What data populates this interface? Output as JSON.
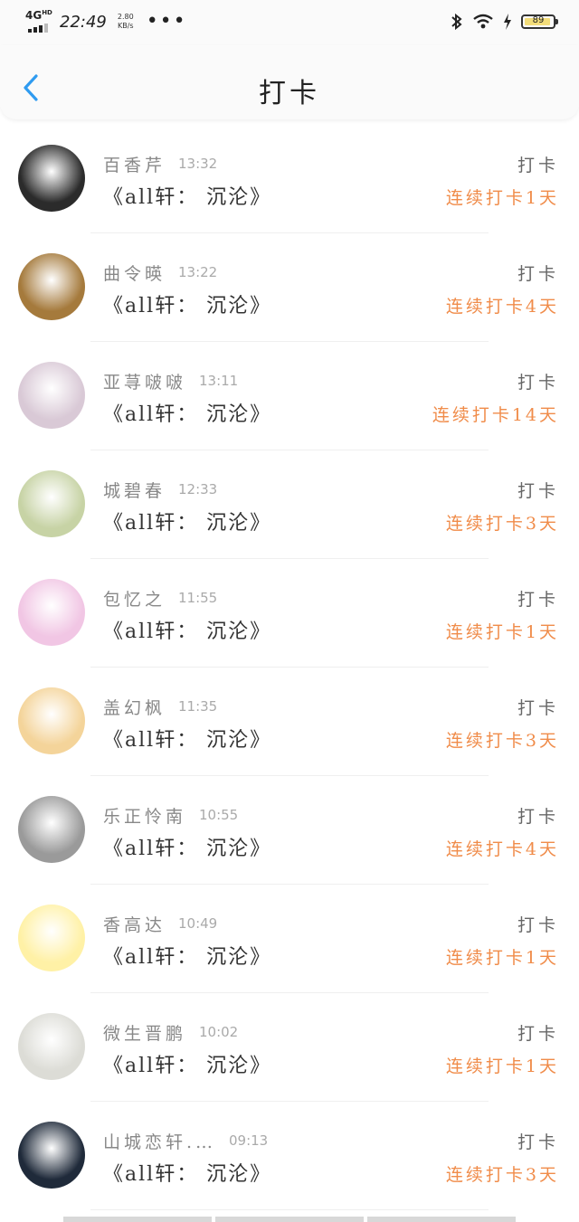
{
  "status": {
    "network": "4G",
    "network_sup": "HD",
    "time": "22:49",
    "speed_value": "2.80",
    "speed_unit": "KB/s",
    "more": "•••",
    "battery": "89"
  },
  "header": {
    "title": "打卡"
  },
  "rows": [
    {
      "name": "百香芹",
      "time": "13:32",
      "book": "《all轩： 沉沦》",
      "action": "打卡",
      "streak": "连续打卡1天",
      "avatar_color": "#2b2b2b"
    },
    {
      "name": "曲令暎",
      "time": "13:22",
      "book": "《all轩： 沉沦》",
      "action": "打卡",
      "streak": "连续打卡4天",
      "avatar_color": "#a57a3c"
    },
    {
      "name": "亚荨啵啵",
      "time": "13:11",
      "book": "《all轩： 沉沦》",
      "action": "打卡",
      "streak": "连续打卡14天",
      "avatar_color": "#d9c9d6"
    },
    {
      "name": "城碧春",
      "time": "12:33",
      "book": "《all轩： 沉沦》",
      "action": "打卡",
      "streak": "连续打卡3天",
      "avatar_color": "#c7d3a5"
    },
    {
      "name": "包忆之",
      "time": "11:55",
      "book": "《all轩： 沉沦》",
      "action": "打卡",
      "streak": "连续打卡1天",
      "avatar_color": "#f1c6e4"
    },
    {
      "name": "盖幻枫",
      "time": "11:35",
      "book": "《all轩： 沉沦》",
      "action": "打卡",
      "streak": "连续打卡3天",
      "avatar_color": "#f4d49a"
    },
    {
      "name": "乐正怜南",
      "time": "10:55",
      "book": "《all轩： 沉沦》",
      "action": "打卡",
      "streak": "连续打卡4天",
      "avatar_color": "#9a9a9a"
    },
    {
      "name": "香高达",
      "time": "10:49",
      "book": "《all轩： 沉沦》",
      "action": "打卡",
      "streak": "连续打卡1天",
      "avatar_color": "#fff1a6"
    },
    {
      "name": "微生晋鹏",
      "time": "10:02",
      "book": "《all轩： 沉沦》",
      "action": "打卡",
      "streak": "连续打卡1天",
      "avatar_color": "#dcdcd6"
    },
    {
      "name": "山城恋轩.…",
      "time": "09:13",
      "book": "《all轩： 沉沦》",
      "action": "打卡",
      "streak": "连续打卡3天",
      "avatar_color": "#1f2a3a"
    }
  ]
}
